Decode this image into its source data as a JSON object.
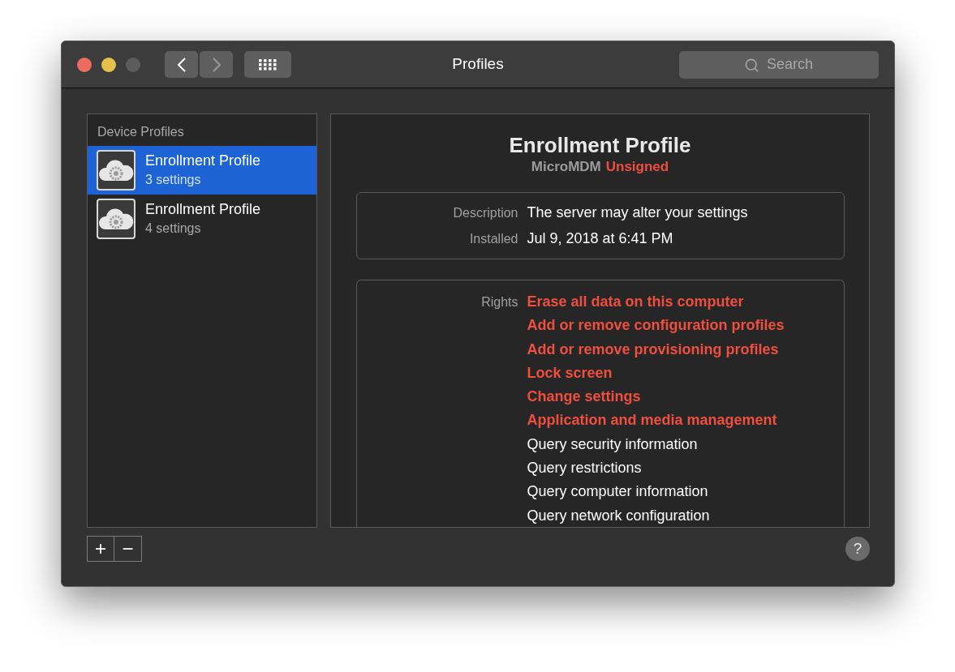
{
  "window": {
    "title": "Profiles",
    "traffic_lights": [
      {
        "kind": "close",
        "disabled": false
      },
      {
        "kind": "minimize",
        "disabled": false
      },
      {
        "kind": "zoom",
        "disabled": true
      }
    ]
  },
  "toolbar": {
    "back": {
      "disabled": false
    },
    "forward": {
      "disabled": true
    },
    "search": {
      "placeholder": "Search"
    }
  },
  "sidebar": {
    "heading": "Device Profiles",
    "items": [
      {
        "title": "Enrollment Profile",
        "subtitle": "3 settings",
        "selected": true
      },
      {
        "title": "Enrollment Profile",
        "subtitle": "4 settings",
        "selected": false
      }
    ]
  },
  "detail": {
    "title": "Enrollment Profile",
    "organization": "MicroMDM",
    "signature": "Unsigned",
    "signed": false,
    "info": [
      {
        "label": "Description",
        "value": "The server may alter your settings"
      },
      {
        "label": "Installed",
        "value": "Jul 9, 2018 at 6:41 PM"
      }
    ],
    "rights": {
      "label": "Rights",
      "items": [
        {
          "text": "Erase all data on this computer",
          "warning": true
        },
        {
          "text": "Add or remove configuration profiles",
          "warning": true
        },
        {
          "text": "Add or remove provisioning profiles",
          "warning": true
        },
        {
          "text": "Lock screen",
          "warning": true
        },
        {
          "text": "Change settings",
          "warning": true
        },
        {
          "text": "Application and media management",
          "warning": true
        },
        {
          "text": "Query security information",
          "warning": false
        },
        {
          "text": "Query restrictions",
          "warning": false
        },
        {
          "text": "Query computer information",
          "warning": false
        },
        {
          "text": "Query network configuration",
          "warning": false
        }
      ]
    }
  },
  "footer": {
    "add": "+",
    "remove": "−",
    "help": "?"
  }
}
